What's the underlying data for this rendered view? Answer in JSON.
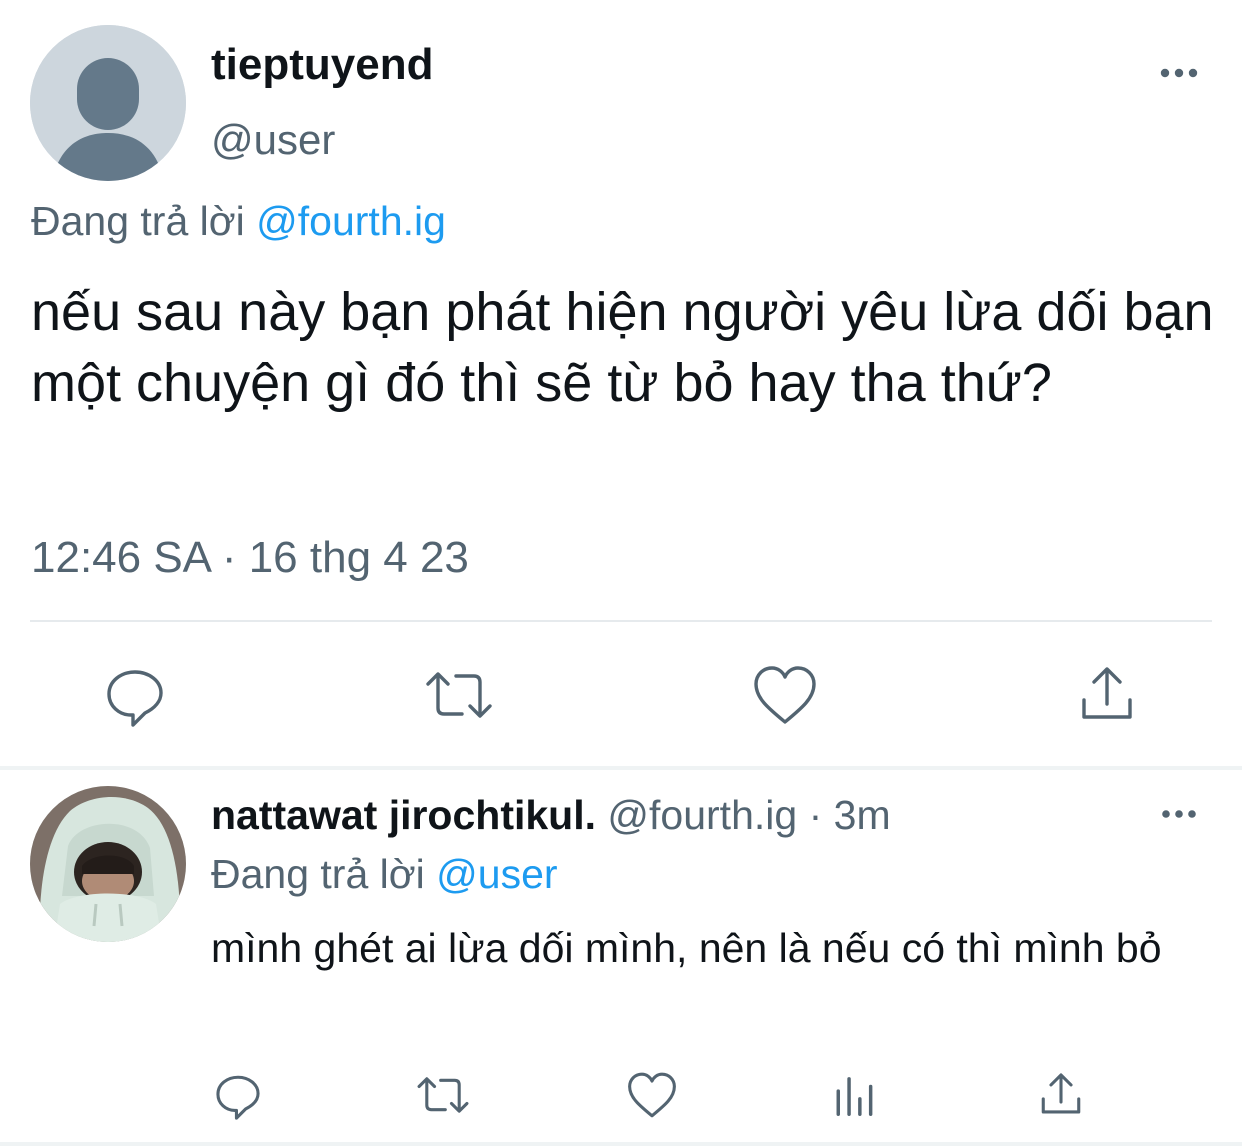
{
  "main_tweet": {
    "author_name": "tieptuyend",
    "author_handle": "@user",
    "replying_prefix": "Đang trả lời",
    "replying_to": "@fourth.ig",
    "text": "nếu sau này bạn phát hiện người yêu lừa dối bạn một chuyện gì đó thì sẽ từ bỏ hay tha thứ?",
    "timestamp": "12:46 SA · 16 thg 4 23",
    "actions": [
      "reply-icon",
      "retweet-icon",
      "like-icon",
      "share-icon"
    ],
    "more_icon": "more-horizontal-icon"
  },
  "reply_tweet": {
    "author_name": "nattawat jirochtikul.",
    "author_handle": "@fourth.ig",
    "separator": "·",
    "time_ago": "3m",
    "replying_prefix": "Đang trả lời",
    "replying_to": "@user",
    "text": "mình ghét ai lừa dối mình, nên là nếu có thì mình bỏ",
    "actions": [
      "reply-icon",
      "retweet-icon",
      "like-icon",
      "analytics-icon",
      "share-icon"
    ],
    "more_icon": "more-horizontal-icon"
  },
  "colors": {
    "text_primary": "#0f1419",
    "text_secondary": "#536471",
    "link": "#1d9bf0",
    "divider": "#e6eaed"
  }
}
